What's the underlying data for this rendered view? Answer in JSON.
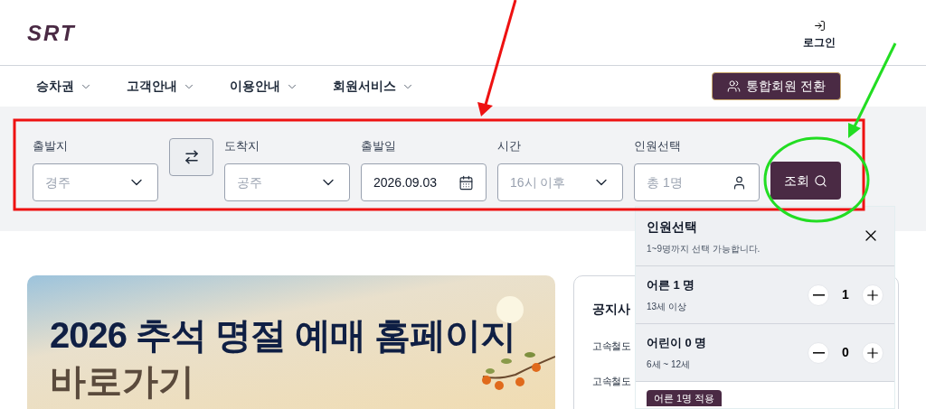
{
  "header": {
    "logo": "SRT",
    "login": "로그인"
  },
  "nav": {
    "items": [
      {
        "label": "승차권"
      },
      {
        "label": "고객안내"
      },
      {
        "label": "이용안내"
      },
      {
        "label": "회원서비스"
      }
    ],
    "member_button": "통합회원 전환"
  },
  "search": {
    "fields": [
      {
        "kind": "select",
        "label": "출발지",
        "value": "경주"
      },
      {
        "kind": "swap"
      },
      {
        "kind": "select",
        "label": "도착지",
        "value": "공주"
      },
      {
        "kind": "date",
        "label": "출발일",
        "value": "2026.09.03"
      },
      {
        "kind": "select",
        "label": "시간",
        "value": "16시 이후"
      },
      {
        "kind": "people",
        "label": "인원선택",
        "value": "총 1명"
      }
    ],
    "submit": "조회"
  },
  "banner": {
    "title": "2026 추석 명절 예매 홈페이지",
    "subtitle": "바로가기"
  },
  "notice": {
    "title": "공지사",
    "items": [
      "고속철도",
      "고속철도"
    ]
  },
  "people_popup": {
    "title": "인원선택",
    "hint": "1~9명까지 선택 가능합니다.",
    "rows": [
      {
        "label": "어른 1 명",
        "note": "13세 이상",
        "count": "1"
      },
      {
        "label": "어린이 0 명",
        "note": "6세 ~ 12세",
        "count": "0"
      }
    ],
    "apply": "어른 1명 적용"
  }
}
